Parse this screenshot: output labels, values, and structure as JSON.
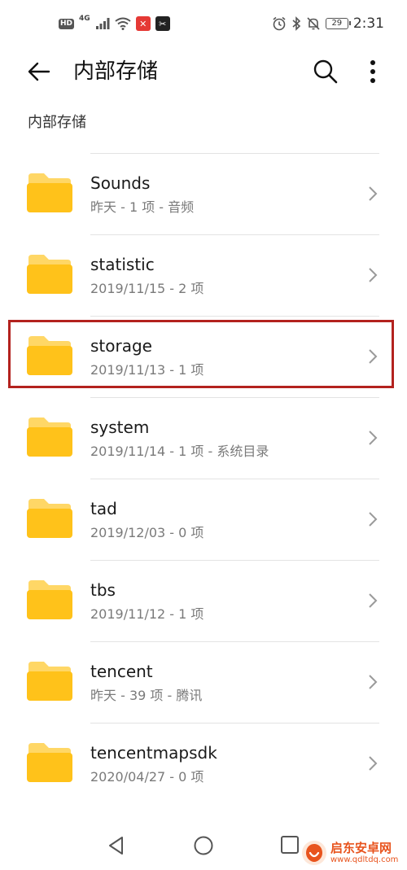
{
  "status_bar": {
    "hd": "HD",
    "network": "4G",
    "battery_level": "29",
    "time": "2:31"
  },
  "header": {
    "title": "内部存储"
  },
  "breadcrumb": "内部存储",
  "colors": {
    "folder": "#ffc21a",
    "folder_tab": "#ffd766",
    "highlight": "#b3221e",
    "watermark": "#e8541e"
  },
  "files": [
    {
      "name": "Sounds",
      "meta": "昨天 - 1 项 - 音频"
    },
    {
      "name": "statistic",
      "meta": "2019/11/15 - 2 项"
    },
    {
      "name": "storage",
      "meta": "2019/11/13 - 1 项"
    },
    {
      "name": "system",
      "meta": "2019/11/14 - 1 项 - 系统目录"
    },
    {
      "name": "tad",
      "meta": "2019/12/03 - 0 项"
    },
    {
      "name": "tbs",
      "meta": "2019/11/12 - 1 项"
    },
    {
      "name": "tencent",
      "meta": "昨天 - 39 项 - 腾讯"
    },
    {
      "name": "tencentmapsdk",
      "meta": "2020/04/27 - 0 项"
    }
  ],
  "watermark": {
    "title": "启东安卓网",
    "url": "www.qdltdq.com"
  }
}
